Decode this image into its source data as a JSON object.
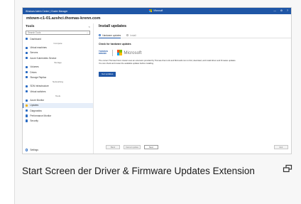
{
  "screenshot": {
    "titlebar": {
      "breadcrumb": "Windows Admin Center | Cluster Manager",
      "brand": "Microsoft",
      "controls": [
        "—",
        "⚙",
        "?"
      ],
      "colors": {
        "bar": "#1f56a6",
        "logo": [
          "#f25022",
          "#7fba00",
          "#00a4ef",
          "#ffb900"
        ]
      }
    },
    "cluster_name": "mtown-c1-01.azshci.thomas-krenn.com",
    "sidebar": {
      "title": "Tools",
      "collapse": "<",
      "search_placeholder": "Search Tools",
      "items": [
        {
          "label": "Dashboard",
          "kind": "item",
          "icon": "dashboard-icon"
        },
        {
          "label": "Compute",
          "kind": "group"
        },
        {
          "label": "Virtual machines",
          "kind": "item",
          "icon": "vm-icon"
        },
        {
          "label": "Servers",
          "kind": "item",
          "icon": "server-icon"
        },
        {
          "label": "Azure Kubernetes Service",
          "kind": "item",
          "icon": "kubernetes-icon"
        },
        {
          "label": "Storage",
          "kind": "group"
        },
        {
          "label": "Volumes",
          "kind": "item",
          "icon": "volume-icon"
        },
        {
          "label": "Drives",
          "kind": "item",
          "icon": "drive-icon"
        },
        {
          "label": "Storage Replica",
          "kind": "item",
          "icon": "replica-icon"
        },
        {
          "label": "Networking",
          "kind": "group"
        },
        {
          "label": "SDN Infrastructure",
          "kind": "item",
          "icon": "network-icon"
        },
        {
          "label": "Virtual switches",
          "kind": "item",
          "icon": "switch-icon"
        },
        {
          "label": "Tools",
          "kind": "group"
        },
        {
          "label": "Azure Monitor",
          "kind": "item",
          "icon": "monitor-icon"
        },
        {
          "label": "Updates",
          "kind": "item",
          "icon": "updates-icon",
          "active": true
        },
        {
          "label": "Diagnostics",
          "kind": "item",
          "icon": "diagnostics-icon"
        },
        {
          "label": "Performance Monitor",
          "kind": "item",
          "icon": "performance-icon"
        },
        {
          "label": "Security",
          "kind": "item",
          "icon": "security-icon"
        }
      ],
      "settings_label": "Settings"
    },
    "main": {
      "title": "Install updates",
      "tabs": [
        {
          "label": "Hardware updates",
          "active": true
        },
        {
          "label": "Install",
          "active": false
        }
      ],
      "section_title": "Check for hardware updates",
      "partner_logo_lines": [
        "THOMAS",
        "KRENN"
      ],
      "microsoft_label": "Microsoft",
      "description_lines": [
        "The current Thomas-Krenn cluster uses an extension provided by Thomas-Krenn.AG and Microsoft.com to find, download, and install driver and firmware updates.",
        "You can check and review the available updates before installing."
      ],
      "primary_button": "Get updates",
      "footer": {
        "back": "Back",
        "cancel": "Cancel update",
        "next": "Next",
        "exit": "Exit"
      }
    }
  },
  "caption": "Start Screen der Driver & Firmware Updates Extension",
  "expand_icon": "expand-icon"
}
